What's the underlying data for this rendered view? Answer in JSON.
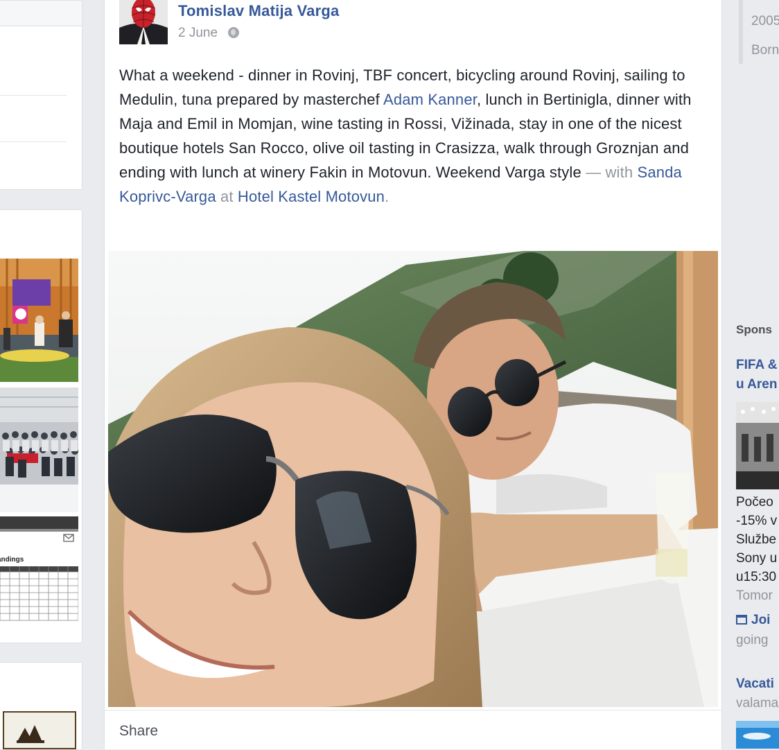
{
  "post": {
    "author": "Tomislav Matija Varga",
    "date": "2 June",
    "privacy_icon": "globe-icon",
    "text_parts": {
      "p1": "What a weekend - dinner in Rovinj, TBF concert, bicycling around Rovinj, sailing to Medulin, tuna prepared by masterchef ",
      "tag_adam": "Adam Kanner",
      "p2": ", lunch in Bertinigla, dinner with Maja and Emil in Momjan, wine tasting in Rossi, Vižinada, stay in one of the nicest boutique hotels San Rocco, olive oil tasting in Crasizza, walk through Groznjan and ending with lunch at winery Fakin in Motovun. Weekend Varga style ",
      "with_label": "— with",
      "tag_sanda": "Sanda Koprivc-Varga",
      "at_label": "at",
      "tag_place": "Hotel Kastel Motovun",
      "end": "."
    },
    "share_label": "Share"
  },
  "right_column": {
    "snippet1": "2005",
    "snippet2": "Born",
    "sponsored_label": "Spons",
    "ad1_title_line1": "FIFA &",
    "ad1_title_line2": "u Aren",
    "ad1_text_lines": [
      "Počeo",
      "-15% v",
      "Službe",
      "Sony u",
      "u15:30"
    ],
    "ad1_time": "Tomor",
    "ad1_join": "Joi",
    "ad1_going": "going",
    "ad2_title": "Vacati",
    "ad2_sub": "valama"
  },
  "left_column": {
    "standings_label": "Standings"
  },
  "colors": {
    "link": "#365899",
    "background": "#e9ebee",
    "muted": "#90949c"
  }
}
